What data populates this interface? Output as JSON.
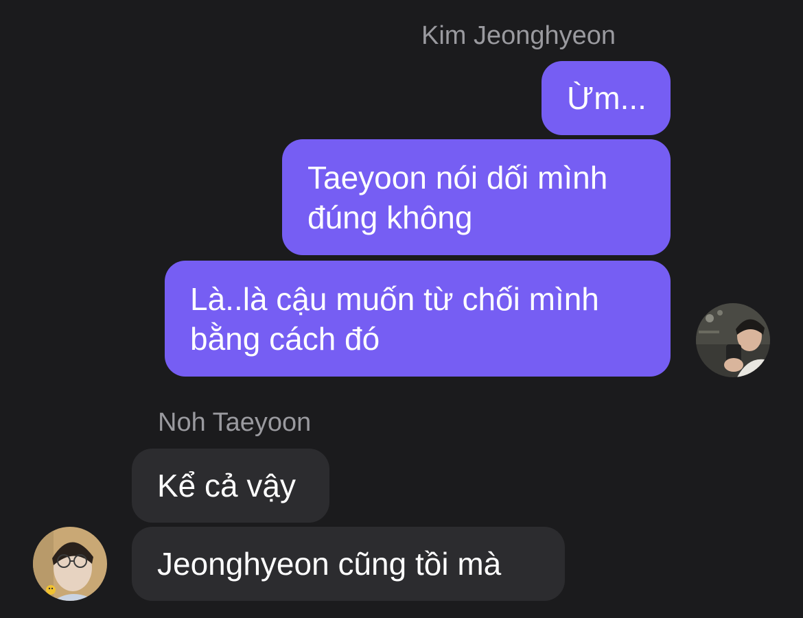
{
  "conversation": {
    "outgoing_sender": "Kim Jeonghyeon",
    "incoming_sender": "Noh Taeyoon",
    "outgoing_messages": [
      {
        "text": "Ừm..."
      },
      {
        "text": "Taeyoon nói dối mình đúng không"
      },
      {
        "text": "Là..là cậu muốn từ chối mình bằng cách đó"
      }
    ],
    "incoming_messages": [
      {
        "text": "Kể cả vậy"
      },
      {
        "text": "Jeonghyeon cũng tồi mà"
      }
    ]
  },
  "colors": {
    "background": "#1b1b1d",
    "outgoing_bubble": "#765ef3",
    "incoming_bubble": "#2c2c2f",
    "sender_name": "#9a9a9f",
    "message_text": "#ffffff"
  }
}
